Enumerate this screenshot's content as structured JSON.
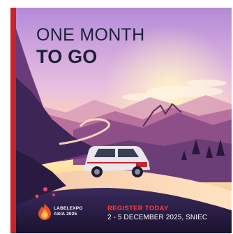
{
  "headline": {
    "line1": "ONE MONTH",
    "line2": "TO GO"
  },
  "logo": {
    "name": "LABELEXPO",
    "subtitle": "ASIA 2025",
    "icon": "flame-logo-icon"
  },
  "cta": {
    "register": "REGISTER TODAY",
    "dates": "2 - 5 DECEMBER 2025, SNIEC"
  },
  "colors": {
    "accent_red": "#c8232b",
    "register_red": "#ff3b3b",
    "headline_navy": "#1d1f3a",
    "sky_purple": "#b48ad8",
    "sunset_yellow": "#ffe5a6"
  }
}
